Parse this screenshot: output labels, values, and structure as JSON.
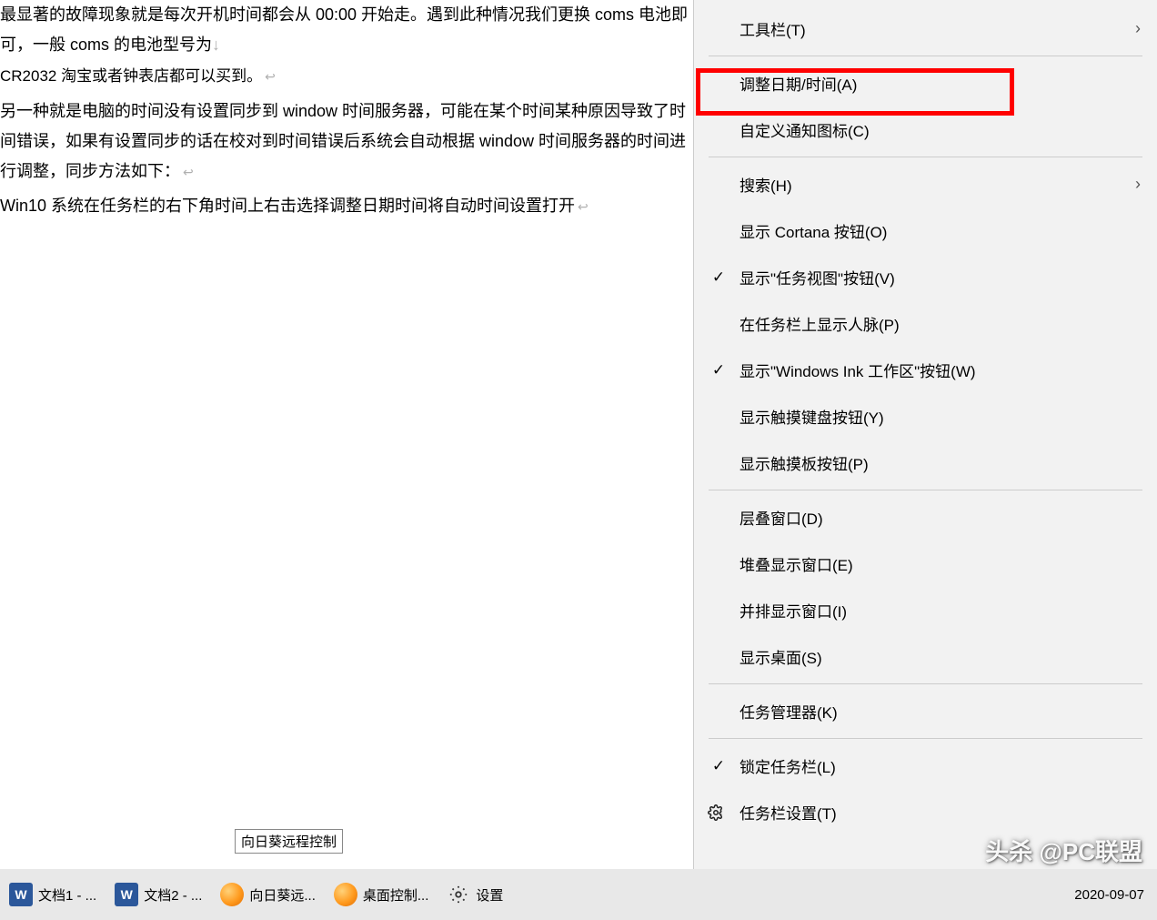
{
  "doc": {
    "p1": "最显著的故障现象就是每次开机时间都会从 00:00 开始走。遇到此种情况我们更换 coms 电池即可，一般 coms 的电池型号为",
    "p1b": "CR2032 淘宝或者钟表店都可以买到。",
    "p2": "另一种就是电脑的时间没有设置同步到 window 时间服务器，可能在某个时间某种原因导致了时间错误，如果有设置同步的话在校对到时间错误后系统会自动根据 window 时间服务器的时间进行调整，同步方法如下：",
    "p3": "Win10  系统在任务栏的右下角时间上右击选择调整日期时间将自动时间设置打开"
  },
  "menu": {
    "toolbars": "工具栏(T)",
    "adjustDateTime": "调整日期/时间(A)",
    "customizeNotif": "自定义通知图标(C)",
    "search": "搜索(H)",
    "showCortana": "显示 Cortana 按钮(O)",
    "showTaskView": "显示\"任务视图\"按钮(V)",
    "showPeople": "在任务栏上显示人脉(P)",
    "showInk": "显示\"Windows Ink 工作区\"按钮(W)",
    "showTouchKb": "显示触摸键盘按钮(Y)",
    "showTouchpad": "显示触摸板按钮(P)",
    "cascade": "层叠窗口(D)",
    "stacked": "堆叠显示窗口(E)",
    "sideBySide": "并排显示窗口(I)",
    "showDesktop": "显示桌面(S)",
    "taskManager": "任务管理器(K)",
    "lockTaskbar": "锁定任务栏(L)",
    "taskbarSettings": "任务栏设置(T)"
  },
  "tooltip": "向日葵远程控制",
  "taskbar": {
    "doc1": "文档1 - ...",
    "doc2": "文档2 - ...",
    "sunflower": "向日葵远...",
    "desktopControl": "桌面控制...",
    "settings": "设置",
    "date": "2020-09-07"
  },
  "watermark": "头杀 @PC联盟"
}
